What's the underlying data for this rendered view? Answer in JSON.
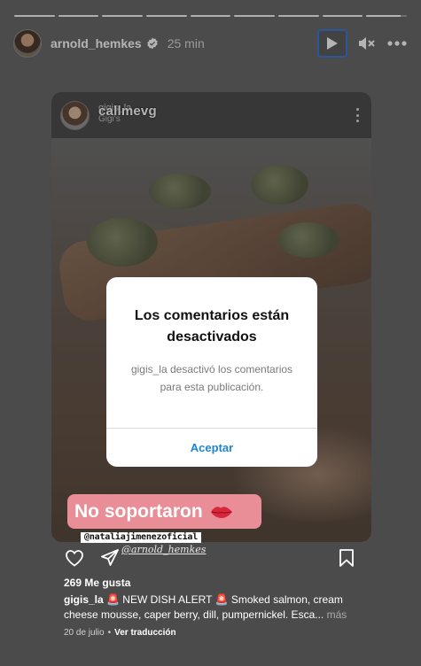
{
  "story": {
    "username": "arnold_hemkes",
    "time": "25 min",
    "segments_total": 9,
    "segments_complete": 8,
    "current_segment_progress": 0.85
  },
  "post": {
    "user_overlay": "callmevg",
    "user_under": "gigis_la",
    "subtitle": "Gigi's",
    "likes": "269 Me gusta",
    "caption_user": "gigis_la",
    "caption_text": "🚨 NEW DISH ALERT 🚨 Smoked salmon, cream cheese mousse, caper berry, dill, pumpernickel. Esca...",
    "caption_more": "más",
    "date": "20 de julio",
    "translate": "Ver traducción"
  },
  "modal": {
    "title": "Los comentarios están desactivados",
    "message": "gigis_la desactivó los comentarios para esta publicación.",
    "button": "Aceptar"
  },
  "sticker": {
    "text": "No soportaron"
  },
  "mentions": {
    "tag": "@nataliajimenezoficial",
    "script": "@arnold_hemkes"
  },
  "colors": {
    "accent_blue": "#1f84d6",
    "sticker_pink": "#e98d96",
    "focus_outline": "#2f6fd6"
  },
  "icons": [
    "verified-badge-icon",
    "play-icon",
    "mute-icon",
    "more-icon",
    "heart-icon",
    "share-icon",
    "bookmark-icon",
    "lips-icon"
  ]
}
